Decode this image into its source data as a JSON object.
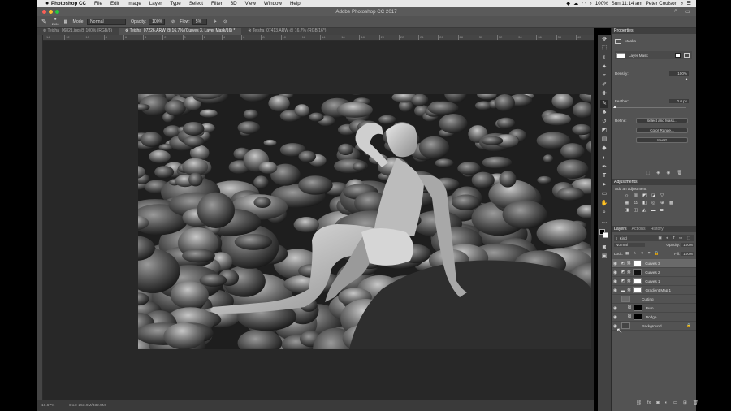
{
  "menubar": {
    "app": "Photoshop CC",
    "items": [
      "File",
      "Edit",
      "Image",
      "Layer",
      "Type",
      "Select",
      "Filter",
      "3D",
      "View",
      "Window",
      "Help"
    ],
    "battery": "100%",
    "clock": "Sun 11:14 am",
    "user": "Peter Coulson"
  },
  "window": {
    "title": "Adobe Photoshop CC 2017"
  },
  "options": {
    "brush_size": "2100",
    "mode_label": "Mode:",
    "mode_value": "Normal",
    "opacity_label": "Opacity:",
    "opacity_value": "100%",
    "flow_label": "Flow:",
    "flow_value": "5%"
  },
  "tabs": [
    "Teisha_06821.jpg @ 100% (RGB/8)",
    "Teisha_07226.ARW @ 16.7% (Curves 3, Layer Mask/16) *",
    "Teisha_07413.ARW @ 16.7% (RGB/16*)"
  ],
  "ruler": [
    "14",
    "12",
    "10",
    "8",
    "6",
    "4",
    "2",
    "0",
    "2",
    "4",
    "6",
    "8",
    "10",
    "12",
    "14",
    "16",
    "18",
    "20",
    "22",
    "24",
    "26",
    "28",
    "30",
    "32",
    "34",
    "36",
    "38",
    "40"
  ],
  "status": {
    "zoom": "16.67%",
    "doc": "Doc: 253.9M/332.5M"
  },
  "properties": {
    "title": "Properties",
    "masks_label": "Masks",
    "layer_mask": "Layer Mask",
    "density_label": "Density:",
    "density_value": "100%",
    "feather_label": "Feather:",
    "feather_value": "0.0 px",
    "refine_label": "Refine:",
    "select_mask": "Select and Mask...",
    "color_range": "Color Range...",
    "invert": "Invert",
    "density_level": 1.0,
    "feather_level": 0.0
  },
  "adjustments": {
    "title": "Adjustments",
    "hint": "Add an adjustment"
  },
  "layers_panel": {
    "tabs": [
      "Layers",
      "Actions",
      "History"
    ],
    "kind": "Kind",
    "blend": "Normal",
    "opacity_label": "Opacity:",
    "opacity_value": "100%",
    "lock_label": "Lock:",
    "fill_label": "Fill:",
    "fill_value": "100%",
    "layers": [
      {
        "name": "Curves 3",
        "selected": true
      },
      {
        "name": "Curves 2",
        "selected": false
      },
      {
        "name": "Curves 1",
        "selected": false
      },
      {
        "name": "Gradient Map 1",
        "selected": false
      },
      {
        "name": "Cutting",
        "selected": false
      },
      {
        "name": "Burn",
        "selected": false
      },
      {
        "name": "Dodge",
        "selected": false
      },
      {
        "name": "Background",
        "selected": false
      }
    ]
  },
  "colors": {
    "accent": "#1f6fde",
    "panel": "#535353",
    "canvas": "#282828"
  }
}
